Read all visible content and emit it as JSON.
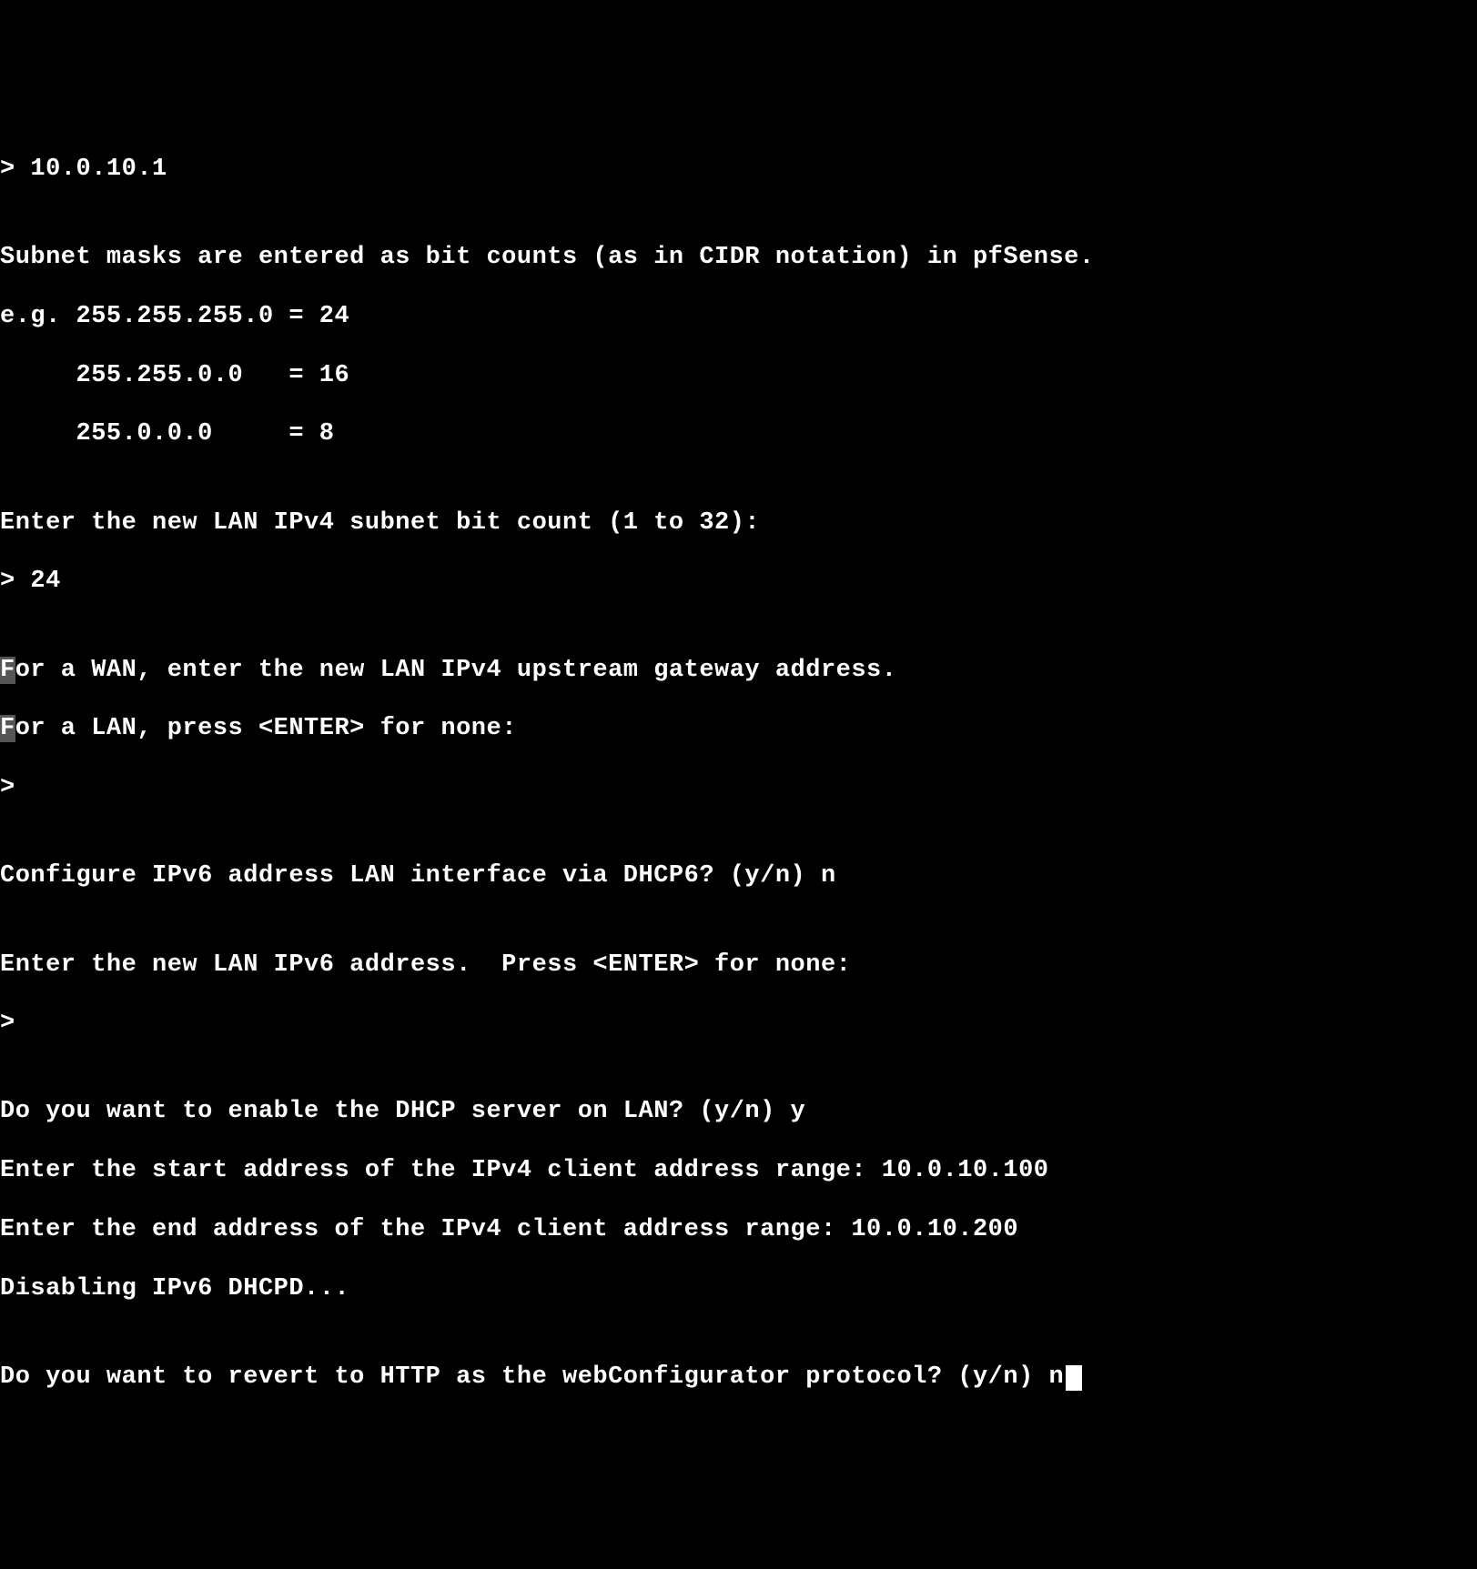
{
  "lines": {
    "l0": "> 10.0.10.1",
    "l1": "",
    "l2": "Subnet masks are entered as bit counts (as in CIDR notation) in pfSense.",
    "l3": "e.g. 255.255.255.0 = 24",
    "l4": "     255.255.0.0   = 16",
    "l5": "     255.0.0.0     = 8",
    "l6": "",
    "l7": "Enter the new LAN IPv4 subnet bit count (1 to 32):",
    "l8": "> 24",
    "l9": "",
    "l10a": "F",
    "l10b": "or a WAN, enter the new LAN IPv4 upstream gateway address.",
    "l11a": "F",
    "l11b": "or a LAN, press <ENTER> for none:",
    "l12": "> ",
    "l13": "",
    "l14": "Configure IPv6 address LAN interface via DHCP6? (y/n) n",
    "l15": "",
    "l16": "Enter the new LAN IPv6 address.  Press <ENTER> for none:",
    "l17": "> ",
    "l18": "",
    "l19": "Do you want to enable the DHCP server on LAN? (y/n) y",
    "l20": "Enter the start address of the IPv4 client address range: 10.0.10.100",
    "l21": "Enter the end address of the IPv4 client address range: 10.0.10.200",
    "l22": "Disabling IPv6 DHCPD...",
    "l23": "",
    "l24": "Do you want to revert to HTTP as the webConfigurator protocol? (y/n) n"
  },
  "inputs": {
    "ip_address": "10.0.10.1",
    "subnet_bits": "24",
    "upstream_gateway": "",
    "dhcp6_enable": "n",
    "ipv6_address": "",
    "dhcp_server_enable": "y",
    "dhcp_range_start": "10.0.10.100",
    "dhcp_range_end": "10.0.10.200",
    "revert_http": "n"
  }
}
